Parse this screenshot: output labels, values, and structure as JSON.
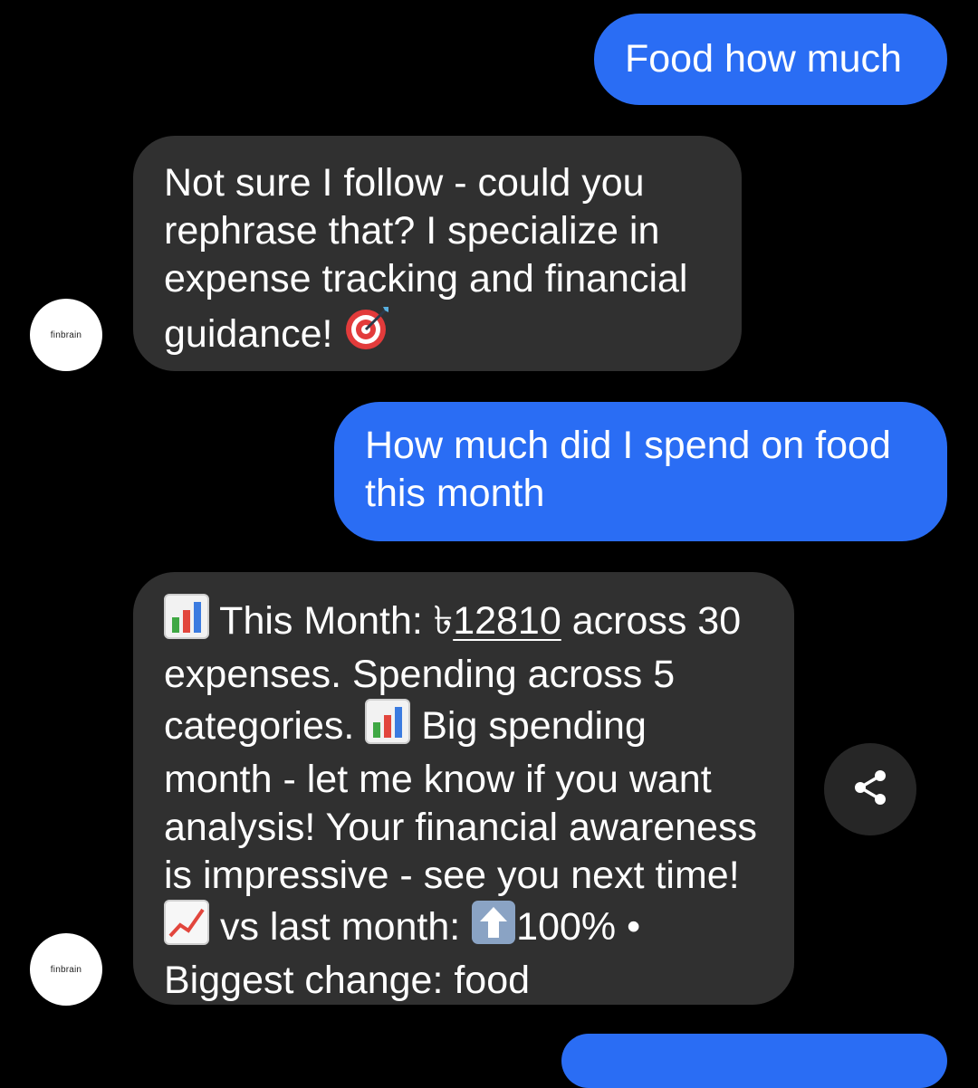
{
  "messages": {
    "m1": {
      "text": "Food how much"
    },
    "m2": {
      "text": "Not sure I follow - could you rephrase that? I specialize in expense tracking and financial guidance!",
      "emoji": "direct-hit-target-icon"
    },
    "m3": {
      "text": "How much did I spend on food this month"
    },
    "m4": {
      "prefix": "This Month: ৳",
      "amount": "12810",
      "part1": " across 30 expenses. Spending across 5 categories.",
      "part2": " Big spending month - let me know if you want analysis! Your financial awareness is impressive - see you next time!",
      "part3": " vs last month:",
      "part4": "100% • Biggest change: food"
    }
  },
  "avatar": {
    "label": "finbrain"
  },
  "colors": {
    "outgoing_bubble": "#2a6df4",
    "incoming_bubble": "#303030",
    "background": "#000000"
  },
  "icons": [
    "bar-chart-icon",
    "chart-increasing-icon",
    "up-arrow-icon",
    "share-icon",
    "direct-hit-target-icon"
  ]
}
